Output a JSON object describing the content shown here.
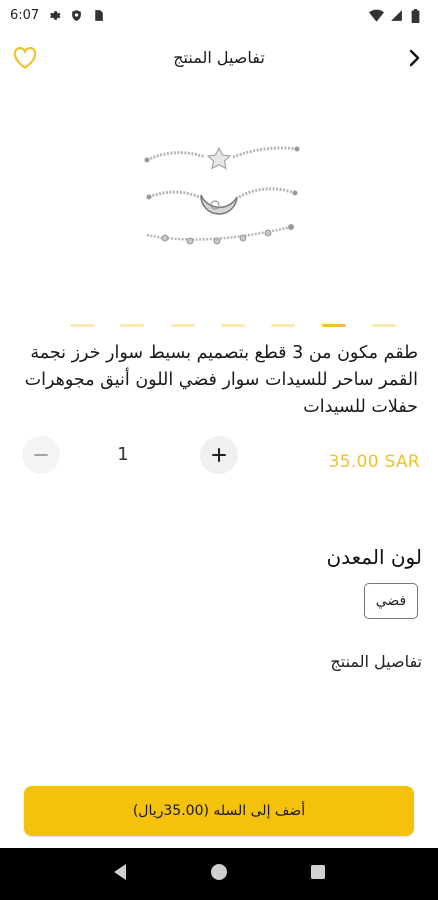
{
  "status_bar": {
    "time": "6:07",
    "icons_left": [
      "gear-icon",
      "shield-icon",
      "sim-card-icon"
    ],
    "icons_right": [
      "wifi-icon",
      "cellular-signal-icon",
      "battery-icon"
    ]
  },
  "app_bar": {
    "title": "تفاصيل المنتج",
    "back_icon": "chevron-right-icon",
    "favorite_icon": "heart-outline-icon"
  },
  "carousel": {
    "slide_count": 7,
    "active_index": 1
  },
  "product": {
    "title": "طقم مكون من 3 قطع بتصميم بسيط سوار خرز نجمة القمر ساحر للسيدات سوار فضي اللون أنيق مجوهرات حفلات للسيدات",
    "price": "35.00 SAR",
    "quantity": "1",
    "image_icon": "bracelet-set-image"
  },
  "metal_color": {
    "heading": "لون المعدن",
    "options": [
      "فضي"
    ]
  },
  "details": {
    "label": "تفاصيل المنتج"
  },
  "cart": {
    "label": "أضف إلى السله (35.00ريال)"
  },
  "colors": {
    "accent": "#f4c20d",
    "price": "#f2c12e",
    "dot_inactive": "#fbeab0"
  }
}
